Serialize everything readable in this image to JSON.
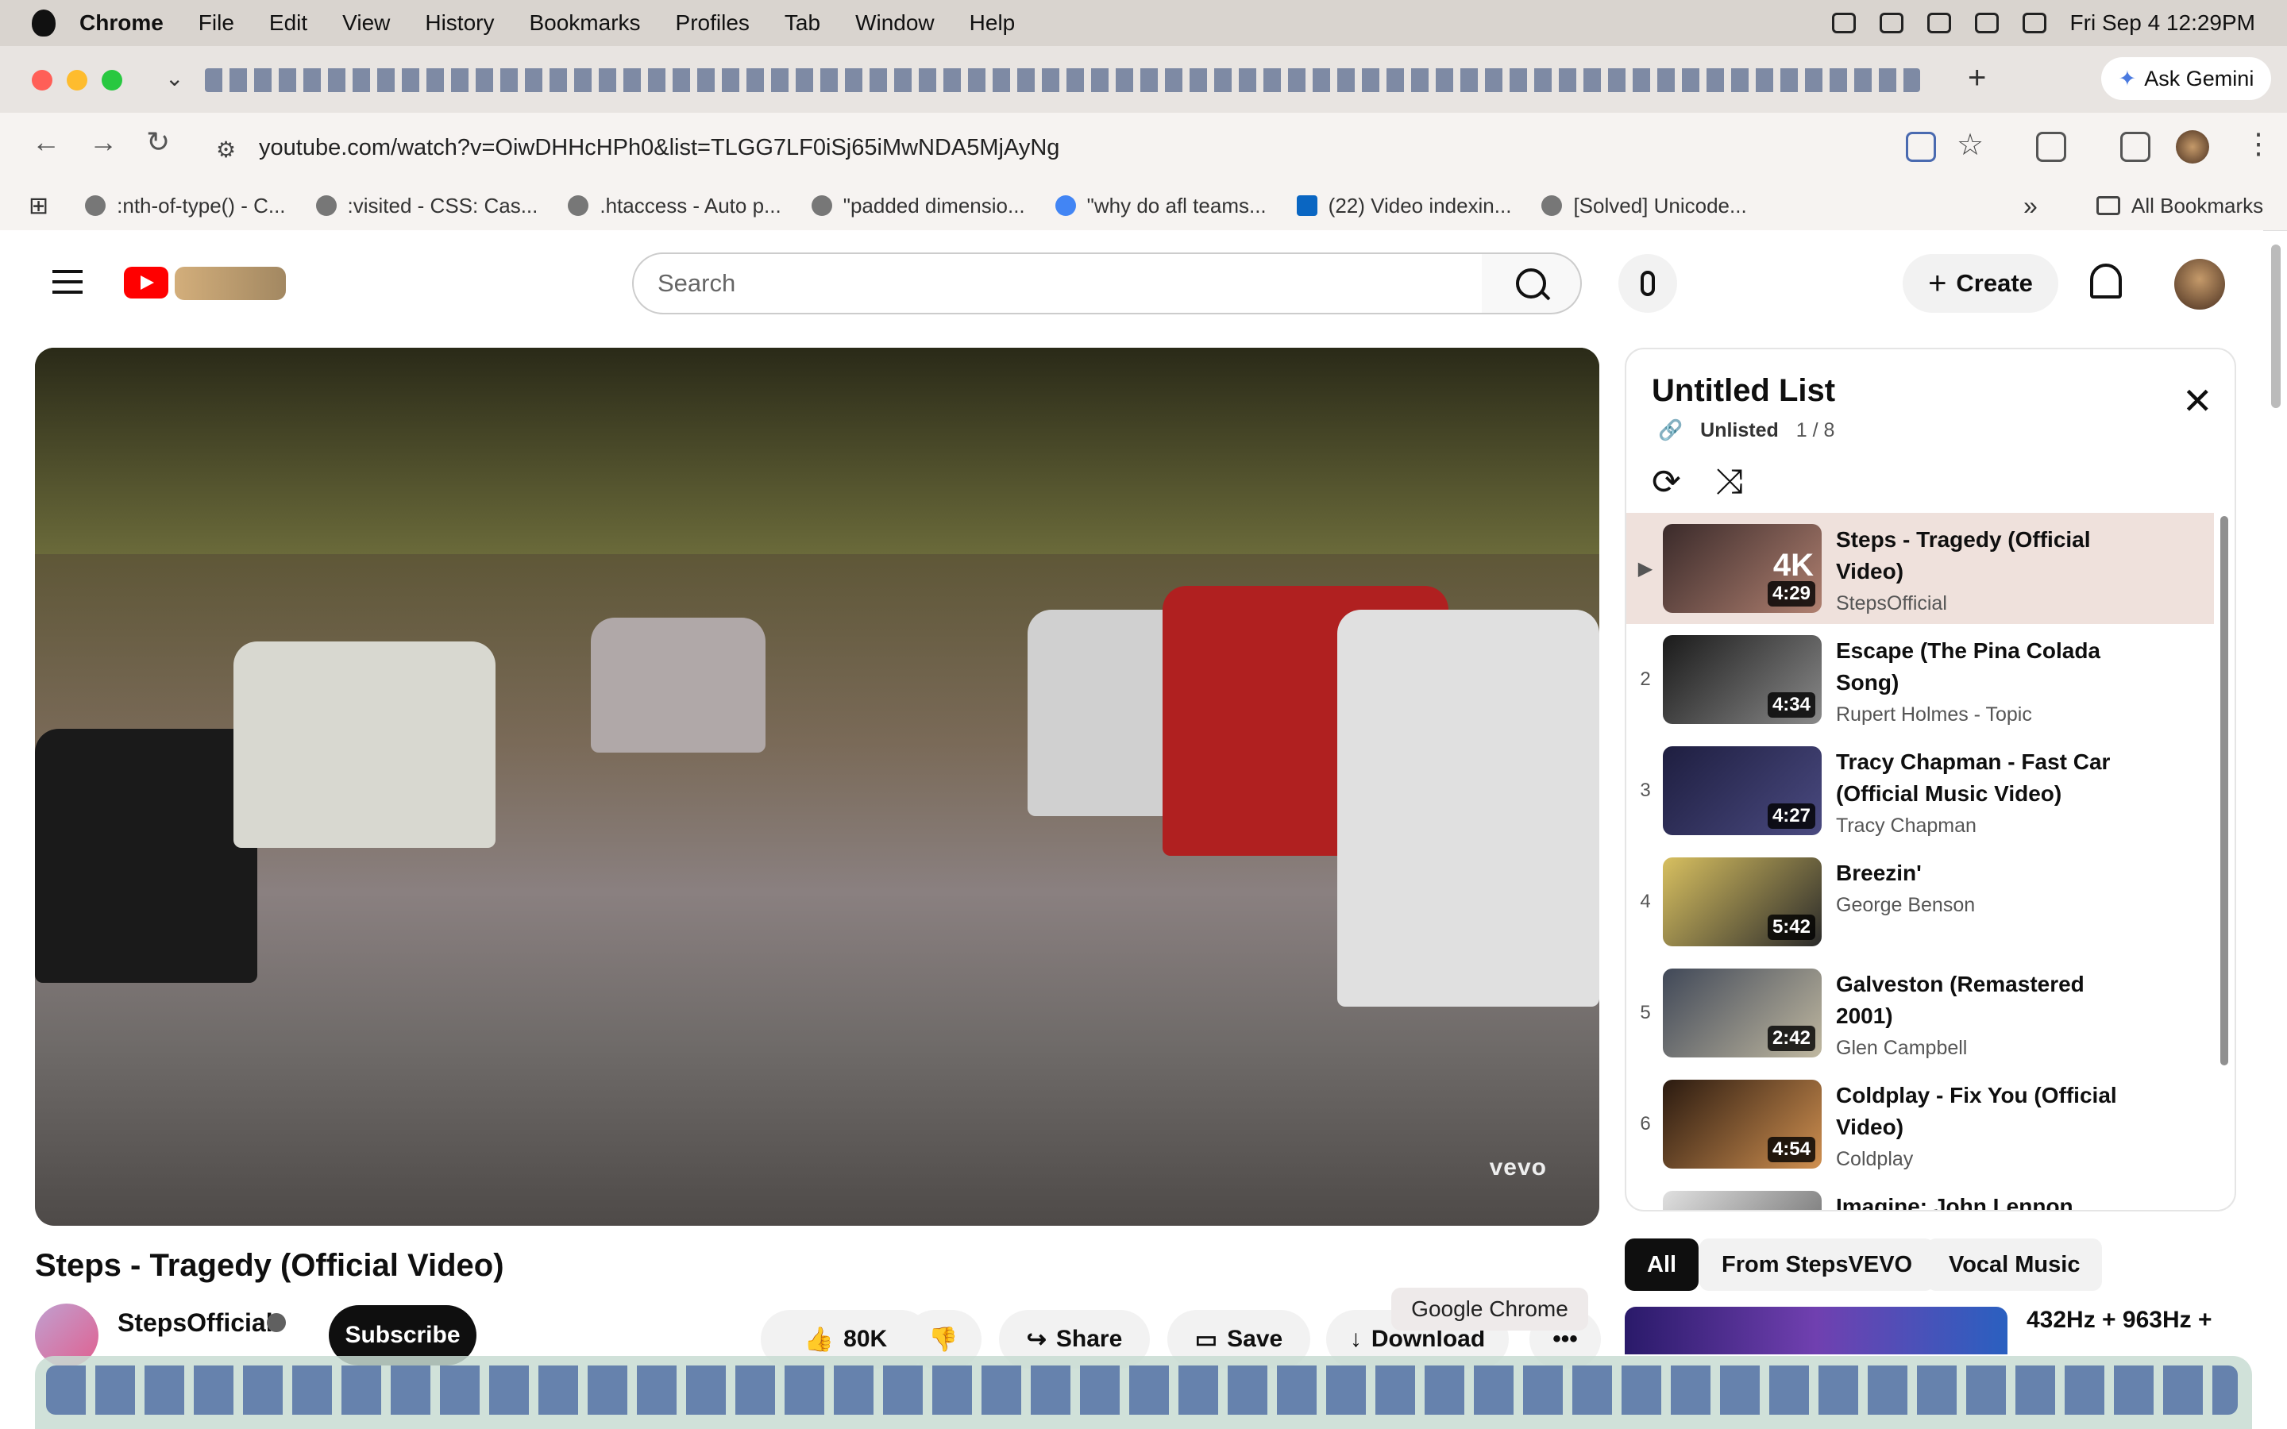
{
  "menubar": {
    "app": "Chrome",
    "items": [
      "File",
      "Edit",
      "View",
      "History",
      "Bookmarks",
      "Profiles",
      "Tab",
      "Window",
      "Help"
    ],
    "clock": "Fri Sep 4  12:29PM"
  },
  "browser": {
    "ask_gemini": "Ask Gemini",
    "new_tab": "+",
    "url": "youtube.com/watch?v=OiwDHHcHPh0&list=TLGG7LF0iSj65iMwNDA5MjAyNg",
    "bookmarks": [
      ":nth-of-type() - C...",
      ":visited - CSS: Cas...",
      ".htaccess - Auto p...",
      "\"padded dimensio...",
      "\"why do afl teams...",
      "(22) Video indexin...",
      "[Solved] Unicode..."
    ],
    "bookmarks_more": "»",
    "all_bookmarks": "All Bookmarks"
  },
  "youtube": {
    "search_placeholder": "Search",
    "create_label": "Create"
  },
  "video": {
    "watermark": "vevo",
    "title": "Steps - Tragedy (Official Video)",
    "channel": "StepsOfficial",
    "subscribe": "Subscribe",
    "likes": "80K",
    "share": "Share",
    "save": "Save",
    "download": "Download",
    "more": "•••"
  },
  "tooltip": "Google Chrome",
  "playlist": {
    "title": "Untitled List",
    "visibility": "Unlisted",
    "position": "1 / 8",
    "close": "✕",
    "items": [
      {
        "index": "▶",
        "title": "Steps - Tragedy (Official Video)",
        "channel": "StepsOfficial",
        "duration": "4:29",
        "badge": "4K"
      },
      {
        "index": "2",
        "title": "Escape (The Pina Colada Song)",
        "channel": "Rupert Holmes - Topic",
        "duration": "4:34"
      },
      {
        "index": "3",
        "title": "Tracy Chapman - Fast Car (Official Music Video)",
        "channel": "Tracy Chapman",
        "duration": "4:27"
      },
      {
        "index": "4",
        "title": "Breezin'",
        "channel": "George Benson",
        "duration": "5:42"
      },
      {
        "index": "5",
        "title": "Galveston (Remastered 2001)",
        "channel": "Glen Campbell",
        "duration": "2:42"
      },
      {
        "index": "6",
        "title": "Coldplay - Fix You (Official Video)",
        "channel": "Coldplay",
        "duration": "4:54"
      },
      {
        "index": "",
        "title": "Imagine: John Lennon",
        "channel": "",
        "duration": ""
      }
    ]
  },
  "chips": [
    "All",
    "From StepsVEVO",
    "Vocal Music"
  ],
  "recommendation": {
    "title": "432Hz + 963Hz +"
  },
  "colors": {
    "accent": "#ff0000",
    "current_item_bg": "#efe1dc"
  }
}
